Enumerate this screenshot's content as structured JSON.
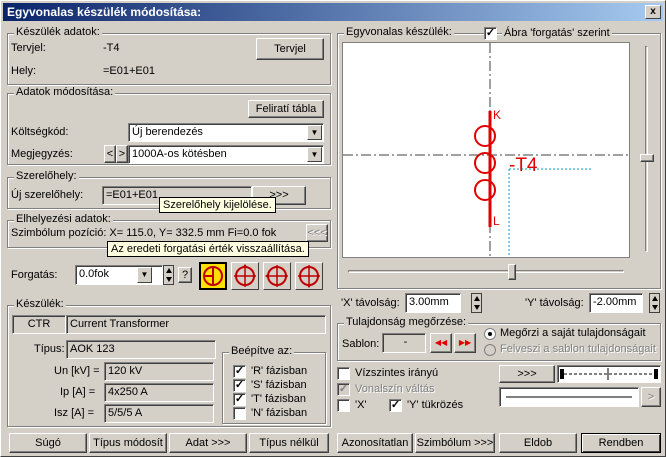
{
  "window": {
    "title": "Egyvonalas készülék módosítása:",
    "close": "x"
  },
  "keszulek_adatok": {
    "legend": "Készülék adatok:",
    "tervjel_label": "Tervjel:",
    "tervjel_value": "-T4",
    "hely_label": "Hely:",
    "hely_value": "=E01+E01",
    "tervjel_button": "Tervjel"
  },
  "adatok_mod": {
    "legend": "Adatok módosítása:",
    "felirati_button": "Feliratí tábla",
    "koltseg_label": "Költségkód:",
    "koltseg_value": "Új berendezés",
    "megj_label": "Megjegyzés:",
    "megj_value": "1000A-os kötésben",
    "prev": "<",
    "next": ">"
  },
  "szerelohely": {
    "legend": "Szerelőhely:",
    "label": "Új szerelőhely:",
    "value": "=E01+E01",
    "button": ">>>",
    "tooltip": "Szerelőhely kijelölése."
  },
  "elhelyezes": {
    "legend": "Elhelyezési adatok:",
    "position_text": "Szimbólum pozíció: X= 115.0, Y= 332.5 mm Fi=0.0 fok",
    "button": "<<<",
    "tooltip": "Az eredeti forgatási érték visszaállítása."
  },
  "forgatas": {
    "label": "Forgatás:",
    "value": "0.0fok",
    "help": "?"
  },
  "keszulek": {
    "legend": "Készülék:",
    "code": "CTR",
    "name": "Current Transformer",
    "tipus_label": "Típus:",
    "tipus_value": "AOK 123",
    "un_label": "Un [kV] =",
    "un_value": "120 kV",
    "ip_label": "Ip [A] =",
    "ip_value": "4x250 A",
    "isz_label": "Isz [A] =",
    "isz_value": "5/5/5 A",
    "beepitve_legend": "Beépítve az:",
    "phases": [
      "'R' fázisban",
      "'S' fázisban",
      "'T' fázisban",
      "'N' fázisban"
    ],
    "phase_checks": [
      "✓",
      "✓",
      "✓",
      ""
    ]
  },
  "preview": {
    "legend": "Egyvonalas készülék:",
    "abra_label": "Ábra 'forgatás' szerint",
    "abra_check": "✓",
    "symbol_label": "-T4",
    "k_label": "K",
    "l_label": "L"
  },
  "tavolsag": {
    "x_label": "'X' távolság:",
    "x_value": "3.00mm",
    "y_label": "'Y' távolság:",
    "y_value": "-2.00mm"
  },
  "tulajdonsag": {
    "legend": "Tulajdonság megőrzése:",
    "sablon_label": "Sablon:",
    "sablon_value": "-",
    "prev": "◀◀",
    "next": "▶▶",
    "opt1": "Megőrzi a saját tulajdonságait",
    "opt2": "Felveszi a sablon tulajdonságait"
  },
  "options": {
    "vizszintes": "Vízszintes irányú",
    "vonalszin": "Vonalszín váltás",
    "vonalszin_check": "✓",
    "x_tukor": "'X'",
    "y_tukor": "'Y' tükrözés",
    "y_tukor_check": "✓",
    "line_button": ">>>",
    "arrow_button": ">"
  },
  "buttons": {
    "sugo": "Súgó",
    "tipus_mod": "Típus módosít",
    "adat": "Adat >>>",
    "tipus_nelkul": "Típus nélkül",
    "azonositatlan": "Azonosítatlan",
    "szimbolum": "Szimbólum >>>",
    "eldob": "Eldob",
    "rendben": "Rendben"
  },
  "colors": {
    "accent_red": "#e00000",
    "cyan": "#00a0c0"
  }
}
